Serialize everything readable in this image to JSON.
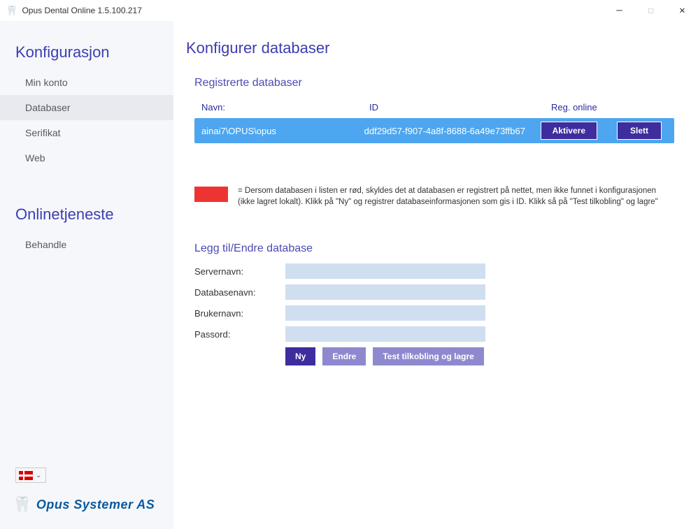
{
  "window": {
    "title": "Opus Dental Online 1.5.100.217"
  },
  "sidebar": {
    "section1": "Konfigurasjon",
    "section2": "Onlinetjeneste",
    "items1": [
      "Min konto",
      "Databaser",
      "Serifikat",
      "Web"
    ],
    "items2": [
      "Behandle"
    ],
    "brand": "Opus Systemer AS"
  },
  "main": {
    "heading": "Konfigurer databaser",
    "section1": "Registrerte databaser",
    "table": {
      "col_name": "Navn:",
      "col_id": "ID",
      "col_reg": "Reg. online",
      "row": {
        "name": "ainai7\\OPUS\\opus",
        "id": "ddf29d57-f907-4a8f-8688-6a49e73ffb67",
        "btn_activate": "Aktivere",
        "btn_delete": "Slett"
      }
    },
    "legend": "= Dersom databasen i listen er rød, skyldes det at databasen er registrert på nettet, men ikke funnet i konfigurasjonen (ikke lagret lokalt). Klikk på \"Ny\" og registrer databaseinformasjonen som gis i ID. Klikk så på \"Test tilkobling\" og lagre\"",
    "section2": "Legg til/Endre database",
    "form": {
      "server": "Servernavn:",
      "db": "Databasenavn:",
      "user": "Brukernavn:",
      "pass": "Passord:",
      "btn_new": "Ny",
      "btn_edit": "Endre",
      "btn_test": "Test tilkobling og lagre"
    }
  }
}
